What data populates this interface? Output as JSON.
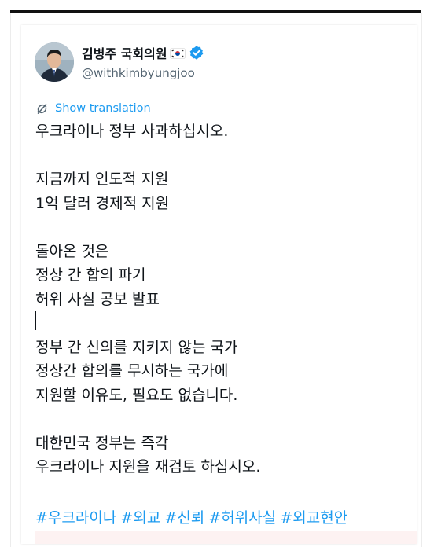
{
  "author": {
    "name": "김병주 국회의원",
    "handle": "@withkimbyungjoo",
    "flag_icon": "south-korea-flag-emoji",
    "verified_icon": "verified-badge-icon",
    "verified_color": "#1d9bf0"
  },
  "translate": {
    "label": "Show translation",
    "icon": "translate-icon"
  },
  "post": {
    "lines": [
      "우크라이나 정부 사과하십시오.",
      "",
      "지금까지 인도적 지원",
      "1억 달러 경제적 지원",
      "",
      "돌아온 것은",
      "정상 간 합의 파기",
      "허위 사실 공보 발표",
      "",
      "정부 간 신의를 지키지 않는 국가",
      "정상간 합의를 무시하는 국가에",
      "지원할 이유도, 필요도 없습니다.",
      "",
      "대한민국 정부는 즉각",
      "우크라이나 지원을 재검토 하십시오."
    ],
    "hashtags": [
      "#우크라이나",
      "#외교",
      "#신뢰",
      "#허위사실",
      "#외교현안"
    ]
  },
  "colors": {
    "text": "#0f1419",
    "secondary": "#536471",
    "link": "#1d9bf0"
  }
}
